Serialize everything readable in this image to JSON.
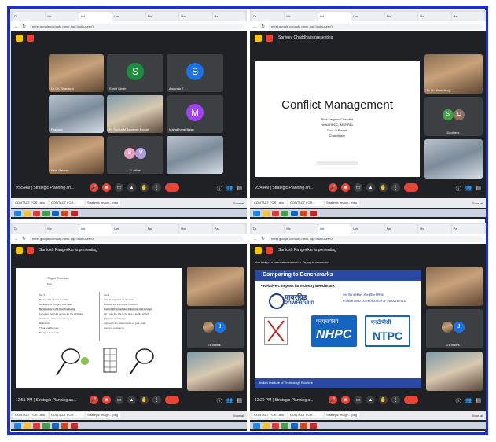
{
  "q1": {
    "tabs": [
      "Dr",
      "Mv",
      "Ind",
      "Uni",
      "Na",
      "Ma",
      "Pa"
    ],
    "url": "meet.google.com/oty-rmwr-hqq?authuser=0",
    "tiles": [
      {
        "name": "Dr DK Bhardwaj",
        "kind": "photo"
      },
      {
        "name": "Sanjit Singh",
        "kind": "avatar",
        "letter": "S",
        "color": "#1e8e3e"
      },
      {
        "name": "Amanda T",
        "kind": "avatar",
        "letter": "S",
        "color": "#1a73e8"
      },
      {
        "name": "Prakash",
        "kind": "photo"
      },
      {
        "name": "Dr Sujata M Jagdeep Pande",
        "kind": "photo"
      },
      {
        "name": "Mahabharat Basu",
        "kind": "avatar",
        "letter": "M",
        "color": "#a142f4"
      },
      {
        "name": "Neel Gaurav",
        "kind": "photo"
      },
      {
        "name": "11 others",
        "kind": "others",
        "l1": "S",
        "l2": "V"
      },
      {
        "name": "",
        "kind": "photo"
      }
    ],
    "time": "9:55 AM | Strategic Planning an...",
    "taskbar": [
      "CONTACT FOR...doc",
      "CONTACT FOR...",
      "Strategic Image...jpeg"
    ],
    "showall": "Show all"
  },
  "q2": {
    "tabs": [
      "Dr",
      "Mv",
      "Ind",
      "Uni",
      "Na",
      "Ma",
      "Pa"
    ],
    "url": "meet.google.com/oty-rmwr-hqq?authuser=0",
    "presenting": "Sanjeev Chaddha is presenting",
    "slide_title": "Conflict Management",
    "slide_lines": [
      "Prof Sanjeev Chaddha",
      "Head HRDC, MGNREL",
      "Govt of Punjab",
      "Chandigarh"
    ],
    "side_tiles": [
      {
        "name": "Dr DK Bhardwaj",
        "kind": "photo"
      },
      {
        "name": "11 others",
        "kind": "others",
        "l1": "S",
        "l2": "D"
      },
      {
        "name": "",
        "kind": "photo"
      }
    ],
    "time": "9:24 AM | Strategic Planning an...",
    "taskbar": [
      "CONTACT FOR...doc",
      "CONTACT FOR...",
      "Strategic Image...jpeg"
    ],
    "showall": "Show all"
  },
  "q3": {
    "tabs": [
      "Dr",
      "Mv",
      "Ind",
      "Uni",
      "Na",
      "Ma",
      "Pa"
    ],
    "url": "meet.google.com/oty-rmwr-hqq?authuser=0",
    "presenting": "Santosh Rangnekar is presenting",
    "slide_heading": "Tug of Exercise",
    "slide_subheading": "Kids",
    "left_col": [
      "Set 1",
      "Be considered and specific",
      "Be aware of thoughts and ideas",
      "Be selective in the thumb selection",
      "Focus on the right people for the activities",
      "Combine it to become strong it",
      "Reflection",
      "Think and Discuss",
      "Be open to change"
    ],
    "right_col": [
      "Set 2",
      "Stay in original lead direction",
      "Develop the vision and missions",
      "Know right to lead and follow one and another",
      "Let's see the Ofs to be take a leader activity",
      "Equip for opportunity",
      "Approach the stated ideals of your goals",
      "planning process to"
    ],
    "side_tiles": [
      {
        "name": "",
        "kind": "photo"
      },
      {
        "name": "21 others",
        "kind": "others",
        "l1": "J",
        "l2": ""
      },
      {
        "name": "",
        "kind": "photo"
      }
    ],
    "time": "12:51 PM | Strategic Planning an...",
    "taskbar": [
      "CONTACT FOR...doc",
      "CONTACT FOR...",
      "Strategic Image...jpeg"
    ],
    "showall": "Show all"
  },
  "q4": {
    "tabs": [
      "Dr",
      "Mv",
      "Ind",
      "Uni",
      "Na",
      "Ma",
      "Pa"
    ],
    "url": "meet.google.com/oty-rmwr-hqq?authuser=0",
    "presenting": "Santosh Rangnekar is presenting",
    "notice": "You lost your network connection. Trying to reconnect.",
    "slide_heading": "Comparing to Benchmarks",
    "slide_sub": "• Relative Compass for Industry Benchmark",
    "brand1": "पावरग्रिड",
    "brand1b": "POWERGRID",
    "brand1_desc": "पावर ग्रिड कॉर्पोरेशन ऑफ इंडिया लिमिटेड",
    "brand1_en": "POWER GRID CORPORATION OF INDIA LIMITED",
    "brand2": "NHPC",
    "brand2_hi": "एनएचपीसी",
    "brand3": "NTPC",
    "brand3_hi": "एनटीपीसी",
    "footer": "Indian Institute of Technology Roorkee",
    "side_tiles": [
      {
        "name": "",
        "kind": "photo"
      },
      {
        "name": "21 others",
        "kind": "others",
        "l1": "J",
        "l2": ""
      },
      {
        "name": "",
        "kind": "photo"
      }
    ],
    "time": "12:29 PM | Strategic Planning a...",
    "taskbar": [
      "CONTACT FOR...doc",
      "CONTACT FOR...",
      "Strategic Image...jpeg"
    ],
    "showall": "Show all"
  },
  "colors": {
    "frame": "#1c2fd6",
    "meet_bg": "#202124",
    "hangup": "#ea4335"
  }
}
